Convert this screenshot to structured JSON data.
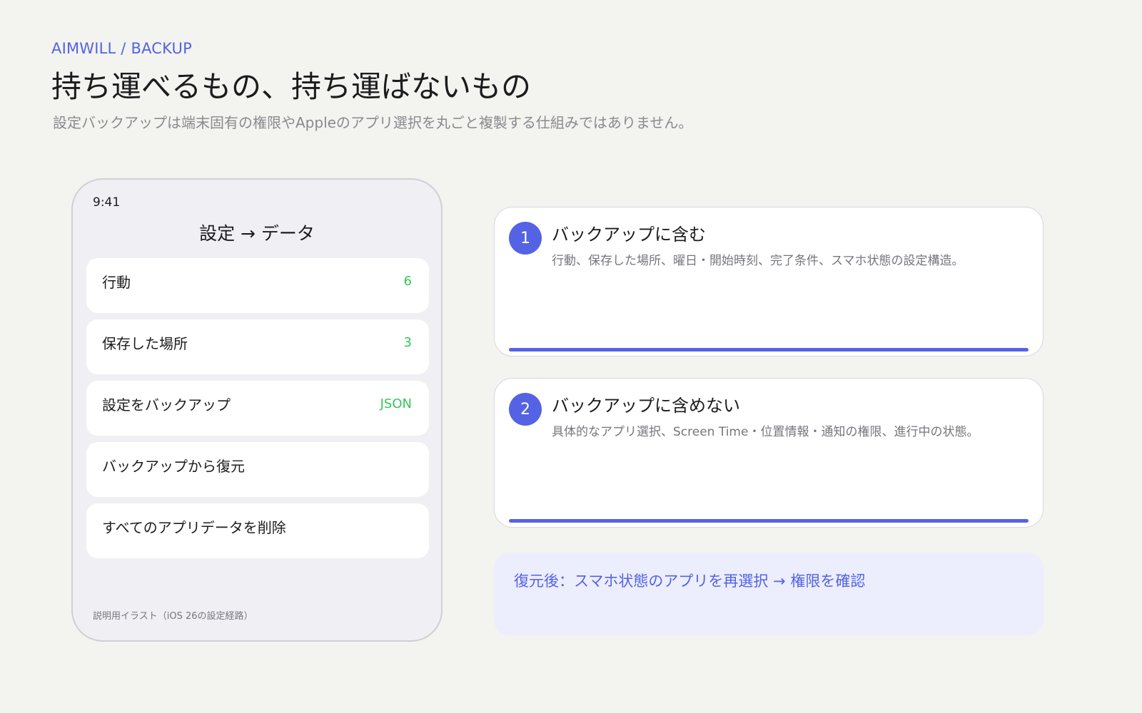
{
  "header": {
    "eyebrow": "AIMWILL / BACKUP",
    "title": "持ち運べるもの、持ち運ばないもの",
    "subtitle": "設定バックアップは端末固有の権限やAppleのアプリ選択を丸ごと複製する仕組みではありません。"
  },
  "phone": {
    "time": "9:41",
    "screen_title": "設定 → データ",
    "rows": [
      {
        "label": "行動",
        "value": "6"
      },
      {
        "label": "保存した場所",
        "value": "3"
      },
      {
        "label": "設定をバックアップ",
        "value": "JSON"
      },
      {
        "label": "バックアップから復元",
        "value": ""
      },
      {
        "label": "すべてのアプリデータを削除",
        "value": ""
      }
    ],
    "caption": "説明用イラスト（iOS 26の設定経路）"
  },
  "cards": [
    {
      "number": "1",
      "title": "バックアップに含む",
      "description": "行動、保存した場所、曜日・開始時刻、完了条件、スマホ状態の設定構造。"
    },
    {
      "number": "2",
      "title": "バックアップに含めない",
      "description": "具体的なアプリ選択、Screen Time・位置情報・通知の権限、進行中の状態。"
    }
  ],
  "note": {
    "text": "復元後：スマホ状態のアプリを再選択 → 権限を確認"
  },
  "colors": {
    "accent": "#5463e3",
    "value_green": "#34c759",
    "background": "#f3f3ef",
    "note_background": "#eceefe"
  }
}
